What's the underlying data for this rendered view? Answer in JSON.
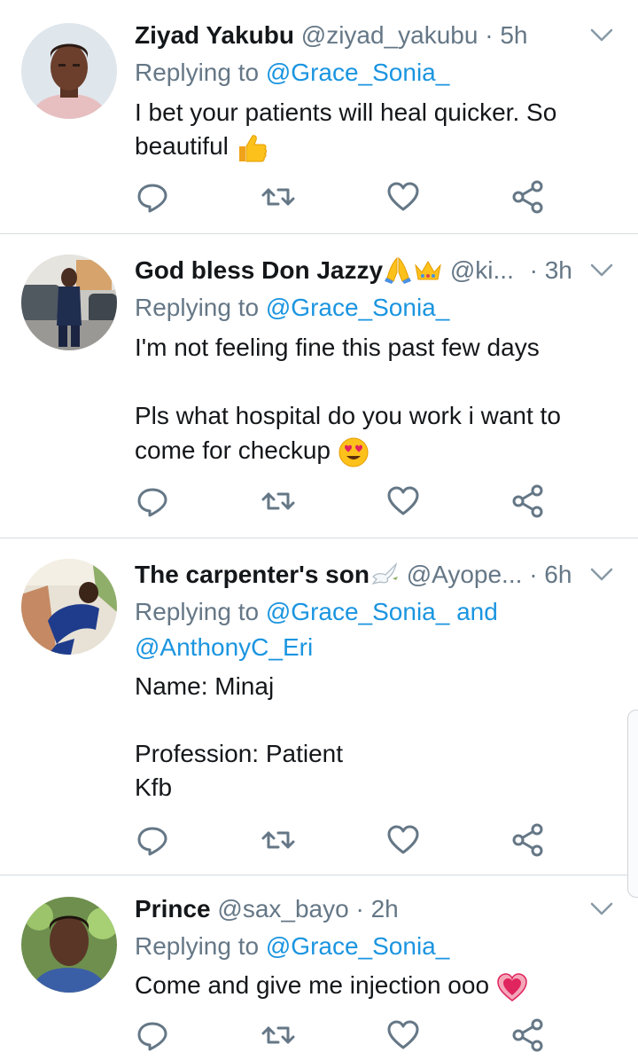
{
  "tweets": [
    {
      "name": "Ziyad Yakubu",
      "handle": "@ziyad_yakubu",
      "time": "5h",
      "replying_prefix": "Replying to",
      "replying_to": "@Grace_Sonia_",
      "replying_extra": "",
      "body_lines": [
        "I bet your patients will heal quicker. So",
        "beautiful"
      ],
      "emoji": [
        "thumbs-up"
      ]
    },
    {
      "name": "God bless Don Jazzy",
      "handle": "@ki...",
      "time": "3h",
      "replying_prefix": "Replying to",
      "replying_to": "@Grace_Sonia_",
      "replying_extra": "",
      "body_lines": [
        "I'm not feeling fine this past few days",
        "",
        "Pls what hospital do you work i want to",
        "come for checkup"
      ],
      "emoji": [
        "folded-hands",
        "crown",
        "heart-eyes-face"
      ]
    },
    {
      "name": "The carpenter's son",
      "handle": "@Ayope...",
      "time": "6h",
      "replying_prefix": "Replying to",
      "replying_to": "@Grace_Sonia_ and",
      "replying_extra": "@AnthonyC_Eri",
      "body_lines": [
        "Name: Minaj",
        "",
        "Profession: Patient",
        "Kfb"
      ],
      "emoji": [
        "dove"
      ]
    },
    {
      "name": "Prince",
      "handle": "@sax_bayo",
      "time": "2h",
      "replying_prefix": "Replying to",
      "replying_to": "@Grace_Sonia_",
      "replying_extra": "",
      "body_lines": [
        "Come and give me injection ooo"
      ],
      "emoji": [
        "heart"
      ]
    }
  ],
  "separator": "·",
  "icons": [
    "reply-icon",
    "retweet-icon",
    "like-icon",
    "share-icon",
    "chevron-down-icon"
  ],
  "colors": {
    "link": "#1b95e0",
    "muted": "#657786",
    "text": "#14171a",
    "divider": "#d6dce0"
  }
}
